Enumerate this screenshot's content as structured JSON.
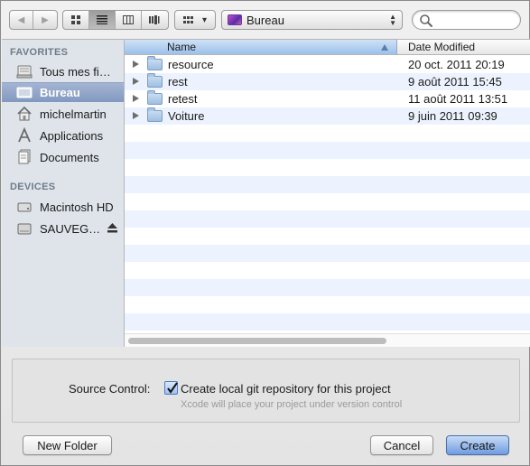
{
  "toolbar": {
    "back_glyph": "◀",
    "forward_glyph": "▶",
    "view_modes": [
      "icon-view",
      "list-view",
      "column-view",
      "coverflow-view"
    ],
    "active_view": "list-view",
    "arrange_glyph": "▾",
    "path_label": "Bureau",
    "search_placeholder": ""
  },
  "sidebar": {
    "favorites_header": "FAVORITES",
    "favorites": [
      {
        "label": "Tous mes fi…",
        "icon": "all-files-icon"
      },
      {
        "label": "Bureau",
        "icon": "desktop-icon",
        "selected": true
      },
      {
        "label": "michelmartin",
        "icon": "home-icon"
      },
      {
        "label": "Applications",
        "icon": "applications-icon"
      },
      {
        "label": "Documents",
        "icon": "documents-icon"
      }
    ],
    "devices_header": "DEVICES",
    "devices": [
      {
        "label": "Macintosh HD",
        "icon": "hard-drive-icon"
      },
      {
        "label": "SAUVEG…",
        "icon": "external-drive-icon",
        "ejectable": true
      }
    ]
  },
  "filelist": {
    "columns": {
      "name": "Name",
      "date": "Date Modified"
    },
    "sort_column": "name",
    "sort_direction": "ascending",
    "rows": [
      {
        "name": "resource",
        "date": "20 oct. 2011 20:19"
      },
      {
        "name": "rest",
        "date": "9 août 2011 15:45"
      },
      {
        "name": "retest",
        "date": "11 août 2011 13:51"
      },
      {
        "name": "Voiture",
        "date": "9 juin 2011 09:39"
      }
    ]
  },
  "accessory": {
    "source_control_label": "Source Control:",
    "checkbox_label": "Create local git repository for this project",
    "checkbox_checked": true,
    "hint": "Xcode will place your project under version control"
  },
  "buttons": {
    "new_folder": "New Folder",
    "cancel": "Cancel",
    "create": "Create"
  },
  "colors": {
    "selection": "#8299c0",
    "default_button": "#6f9ce0",
    "sidebar_bg": "#dee4ea",
    "row_stripe": "#edf3fe"
  }
}
